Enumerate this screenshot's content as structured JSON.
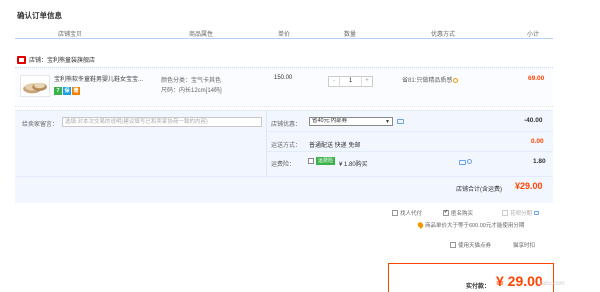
{
  "page_title": "确认订单信息",
  "table_header": {
    "store_goods": "店铺宝贝",
    "attributes": "商品属性",
    "unit_price": "单价",
    "quantity": "数量",
    "discount": "优惠方式",
    "subtotal": "小计"
  },
  "shop": {
    "label": "店铺：",
    "name": "宝利熊童装旗舰店"
  },
  "item": {
    "name": "宝利熊软冬童鞋男婴儿鞋女宝宝...",
    "badges": [
      "7",
      "保",
      "赠"
    ],
    "color_attr": "颜色分类：宝气卡其色",
    "size_attr": "尺码：内长12cm[14码]",
    "price": "150.00",
    "quantity": "1",
    "qty_minus": "-",
    "qty_plus": "+",
    "promo": "省81:只做精品质感",
    "subtotal": "69.00"
  },
  "message": {
    "label": "给卖家留言：",
    "placeholder": "选填:对本次交易的说明(建议填写已和卖家协商一致的内容)"
  },
  "shop_coupon": {
    "label": "店铺优惠：",
    "selected": "省40元:内部券",
    "value": "-40.00"
  },
  "shipping": {
    "label": "运送方式：",
    "text": "普通配送 快递 免邮",
    "value": "0.00"
  },
  "insurance": {
    "label": "运费险：",
    "tag": "运费险",
    "text": "¥ 1.80购买",
    "value": "1.80"
  },
  "shop_total": {
    "label": "店铺合计(含运费)",
    "value": "¥29.00"
  },
  "options": {
    "anonymous_pay": "找人代付",
    "anonymous_buy": "匿名购买",
    "installment": "花呗分期",
    "installment_note": "商品单价大于等于600.00元才能使用分期",
    "tmall_points": "使用天猫点券",
    "discount_link": "猫享时扣",
    "anonymous_buy_checked": true
  },
  "payment": {
    "label": "实付款：",
    "value": "¥ 29.00"
  },
  "watermark": "fabu.com",
  "colors": {
    "accent_red": "#ff4400",
    "header_blue": "#b2d1ff",
    "badge_green": "#3cb34a"
  }
}
